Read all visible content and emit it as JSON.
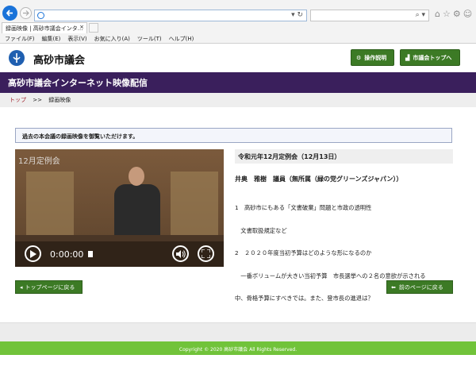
{
  "browser": {
    "tab_title": "録画映像 | 高砂市議会インタ...",
    "menu": [
      "ファイル(F)",
      "編集(E)",
      "表示(V)",
      "お気に入り(A)",
      "ツール(T)",
      "ヘルプ(H)"
    ],
    "addr_tools": "▾ ↻",
    "search_tools": "⌕ ▾"
  },
  "header": {
    "site_name": "高砂市議会",
    "help_button": "操作説明",
    "top_button": "市議会トップへ"
  },
  "page": {
    "title": "高砂市議会インターネット映像配信",
    "breadcrumb": {
      "home": "トップ",
      "sep": ">>",
      "current": "録画映像"
    },
    "notice": "過去の本会議の録画映像を御覧いただけます。"
  },
  "video": {
    "overlay_label": "12月定例会",
    "time": "0:00:00"
  },
  "session": {
    "title": "令和元年12月定例会（12月13日）",
    "speaker": "井奥　雅樹　議員（無所属（緑の党グリーンズジャパン））",
    "topics": [
      "1　高砂市にもある「文書破棄」問題と市政の透明性",
      "　文書取扱規定など",
      "2　２０２０年度当初予算はどのような形になるのか",
      "　一番ボリュームが大きい当初予算　市長選挙への２名の意欲が示される",
      "中、骨格予算にすべきでは。また、登市長の進退は？"
    ]
  },
  "buttons": {
    "to_top": "トップページに戻る",
    "back": "前のページに戻る"
  },
  "footer": {
    "copyright": "Copyright © 2020 高砂市議会 All Rights Reserved."
  }
}
